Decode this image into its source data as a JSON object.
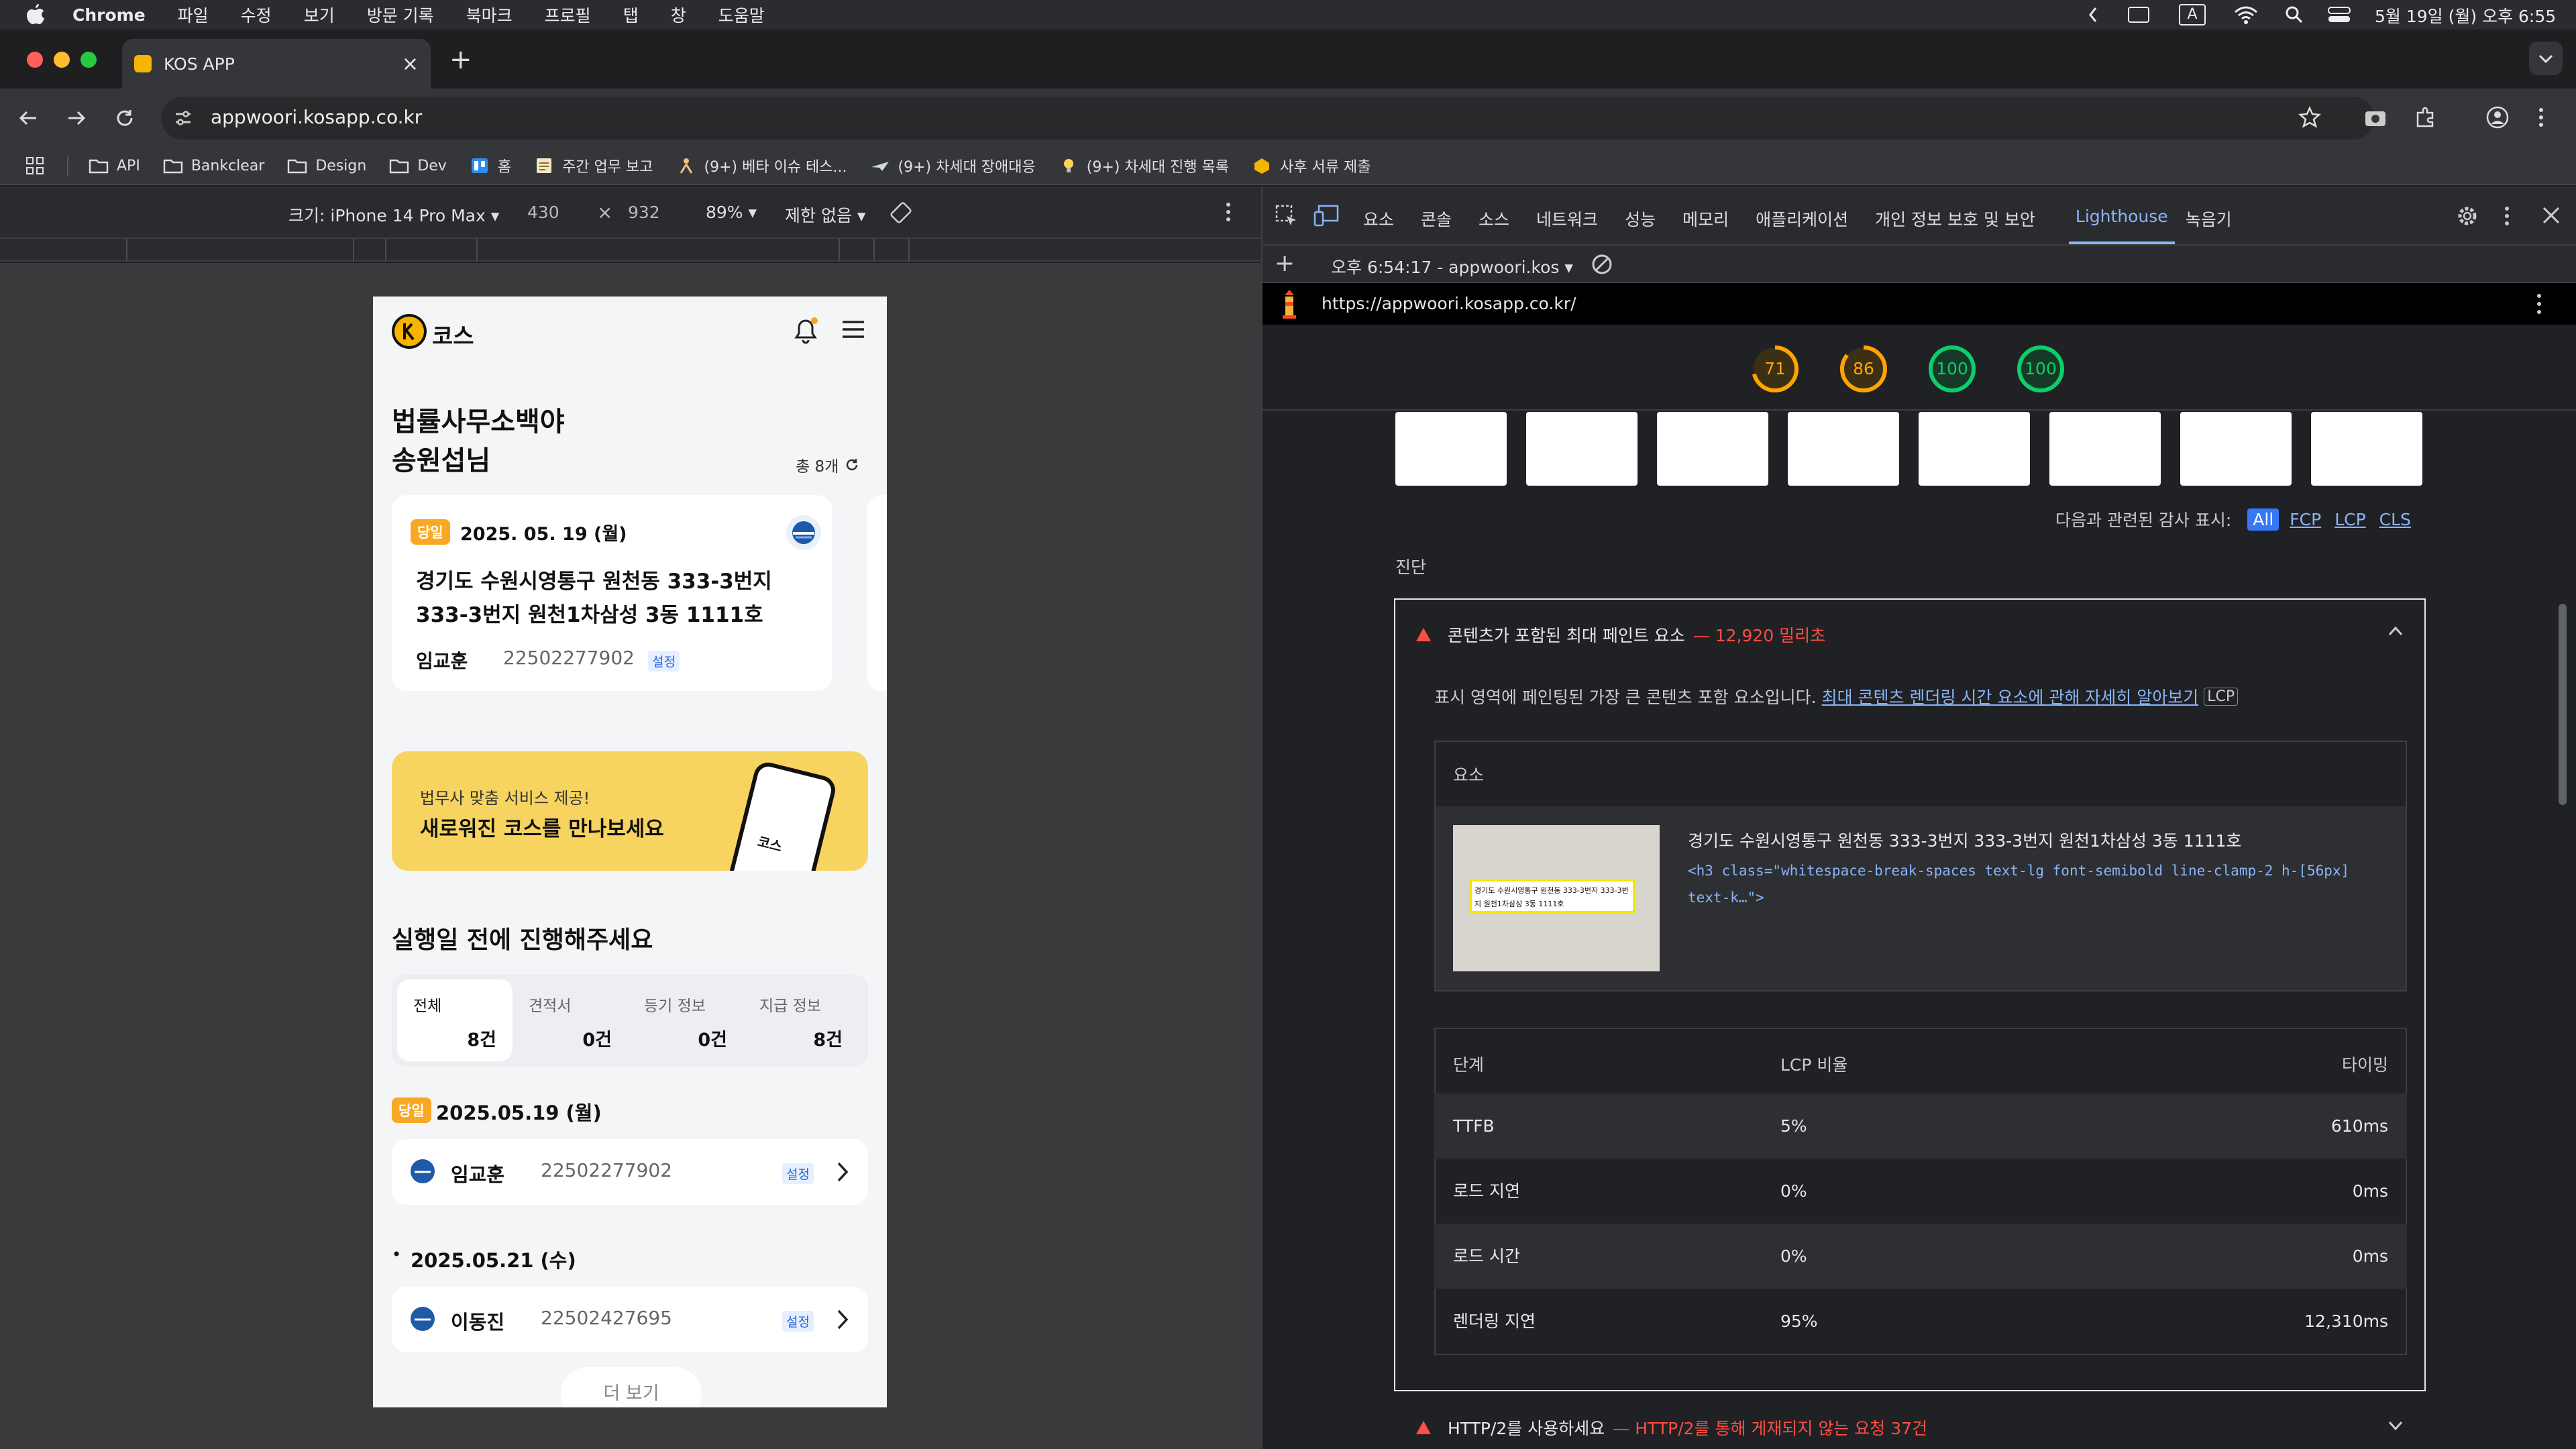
{
  "mac_menubar": {
    "app": "Chrome",
    "items": [
      "파일",
      "수정",
      "보기",
      "방문 기록",
      "북마크",
      "프로필",
      "탭",
      "창",
      "도움말"
    ],
    "clock": "5월 19일 (월) 오후 6:55"
  },
  "browser": {
    "tab_title": "KOS APP",
    "url": "appwoori.kosapp.co.kr",
    "bookmarks": [
      "API",
      "Bankclear",
      "Design",
      "Dev",
      "홈",
      "주간 업무 보고",
      "(9+) 베타 이슈 테스...",
      "(9+) 차세대 장애대응",
      "(9+) 차세대 진행 목록",
      "사후 서류 제출"
    ]
  },
  "device_toolbar": {
    "device": "크기: iPhone 14 Pro Max",
    "width": "430",
    "times": "×",
    "height": "932",
    "zoom": "89%",
    "throttle": "제한 없음"
  },
  "app": {
    "logo_text": "코스",
    "greeting_line1": "법률사무소백야",
    "greeting_line2": "송원섭님",
    "total": "총 8개",
    "card": {
      "badge": "당일",
      "date": "2025. 05. 19 (월)",
      "address": "경기도 수원시영통구 원천동  333-3번지 333-3번지 원천1차삼성 3동 1111호",
      "name": "임교훈",
      "number": "22502277902",
      "setting": "설정"
    },
    "banner": {
      "small": "법무사 맞춤 서비스 제공!",
      "big": "새로워진 코스를 만나보세요",
      "phone_logo": "코스"
    },
    "section_title": "실행일 전에 진행해주세요",
    "filters": [
      {
        "label": "전체",
        "count": "8건"
      },
      {
        "label": "견적서",
        "count": "0건"
      },
      {
        "label": "등기 정보",
        "count": "0건"
      },
      {
        "label": "지급 정보",
        "count": "8건"
      }
    ],
    "groups": [
      {
        "badge": "당일",
        "date": "2025.05.19 (월)",
        "name": "임교훈",
        "number": "22502277902",
        "setting": "설정"
      },
      {
        "badge": "•",
        "date": "2025.05.21 (수)",
        "name": "이동진",
        "number": "22502427695",
        "setting": "설정"
      }
    ],
    "more": "더 보기"
  },
  "devtools": {
    "tabs": [
      "요소",
      "콘솔",
      "소스",
      "네트워크",
      "성능",
      "메모리",
      "애플리케이션",
      "개인 정보 보호 및 보안",
      "Lighthouse",
      "녹음기"
    ],
    "active_tab": "Lighthouse",
    "report_select": "오후 6:54:17 - appwoori.kos",
    "report_url": "https://appwoori.kosapp.co.kr/",
    "scores": [
      {
        "value": "71",
        "color": "#ffa400"
      },
      {
        "value": "86",
        "color": "#ffa400"
      },
      {
        "value": "100",
        "color": "#0cce6b"
      },
      {
        "value": "100",
        "color": "#0cce6b"
      }
    ],
    "filter_label": "다음과 관련된 감사 표시:",
    "filters": [
      "All",
      "FCP",
      "LCP",
      "CLS"
    ],
    "diagnostics_label": "진단",
    "audit": {
      "title": "콘텐츠가 포함된 최대 페인트 요소",
      "value": "— 12,920 밀리초",
      "desc": "표시 영역에 페인팅된 가장 큰 콘텐츠 포함 요소입니다.",
      "desc_link": "최대 콘텐츠 렌더링 시간 요소에 관해 자세히 알아보기",
      "desc_tag": "LCP",
      "element_header": "요소",
      "element_text": "경기도 수원시영통구 원천동 333-3번지 333-3번지 원천1차삼성 3동 1111호",
      "element_code": "<h3 class=\"whitespace-break-spaces text-lg font-semibold line-clamp-2 h-[56px] text-k…\">",
      "thumb_text": "경기도 수원시영통구 원천동  333-3번지 333-3번지 원천1차삼성 3동 1111호",
      "table_headers": [
        "단계",
        "LCP 비율",
        "타이밍"
      ],
      "rows": [
        {
          "phase": "TTFB",
          "pct": "5%",
          "time": "610ms"
        },
        {
          "phase": "로드 지연",
          "pct": "0%",
          "time": "0ms"
        },
        {
          "phase": "로드 시간",
          "pct": "0%",
          "time": "0ms"
        },
        {
          "phase": "렌더링 지연",
          "pct": "95%",
          "time": "12,310ms"
        }
      ]
    },
    "audit2": {
      "title": "HTTP/2를 사용하세요",
      "value": "— HTTP/2를 통해 게재되지 않는 요청 37건"
    }
  }
}
